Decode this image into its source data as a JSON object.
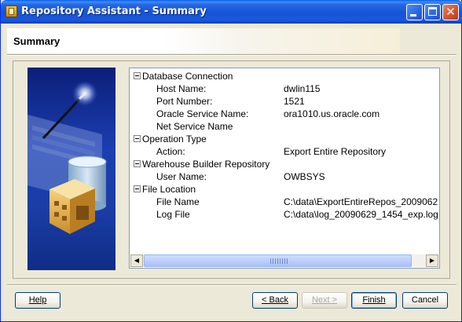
{
  "window": {
    "title": "Repository Assistant - Summary"
  },
  "header": {
    "title": "Summary"
  },
  "summary_tree": {
    "sections": [
      {
        "label": "Database Connection",
        "items": [
          {
            "label": "Host Name:",
            "value": "dwlin115"
          },
          {
            "label": "Port Number:",
            "value": "1521"
          },
          {
            "label": "Oracle Service Name:",
            "value": "ora1010.us.oracle.com"
          },
          {
            "label": "Net Service Name",
            "value": ""
          }
        ]
      },
      {
        "label": "Operation Type",
        "items": [
          {
            "label": "Action:",
            "value": "Export Entire Repository"
          }
        ]
      },
      {
        "label": "Warehouse Builder Repository",
        "items": [
          {
            "label": "User Name:",
            "value": "OWBSYS"
          }
        ]
      },
      {
        "label": "File Location",
        "items": [
          {
            "label": "File Name",
            "value": "C:\\data\\ExportEntireRepos_2009062"
          },
          {
            "label": "Log File",
            "value": "C:\\data\\log_20090629_1454_exp.log"
          }
        ]
      }
    ]
  },
  "buttons": {
    "help": "Help",
    "back": "< Back",
    "next": "Next >",
    "finish": "Finish",
    "cancel": "Cancel"
  },
  "colors": {
    "title_bar": "#2667e3",
    "dialog_bg": "#ece9d8",
    "art_bg": "#1b3eb0"
  },
  "icons": {
    "app": "repository-icon",
    "tree_toggle": "collapse-icon"
  }
}
